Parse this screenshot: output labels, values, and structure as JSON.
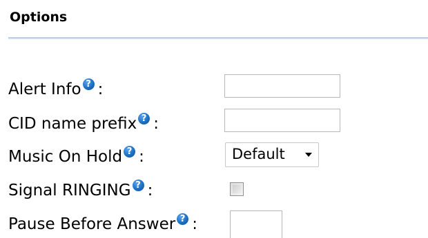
{
  "section": {
    "title": "Options"
  },
  "fields": {
    "alert_info": {
      "label": "Alert Info",
      "value": ""
    },
    "cid_name_prefix": {
      "label": "CID name prefix",
      "value": ""
    },
    "music_on_hold": {
      "label": "Music On Hold",
      "selected": "Default"
    },
    "signal_ringing": {
      "label": "Signal RINGING",
      "checked": false
    },
    "pause_before_answer": {
      "label": "Pause Before Answer",
      "value": ""
    }
  },
  "help_glyph": "?",
  "colon": ":",
  "icons": {
    "help": "help-icon",
    "dropdown": "caret-down-icon"
  },
  "colors": {
    "help_icon": "#1d6fc4",
    "rule": "#a9c4e3"
  }
}
